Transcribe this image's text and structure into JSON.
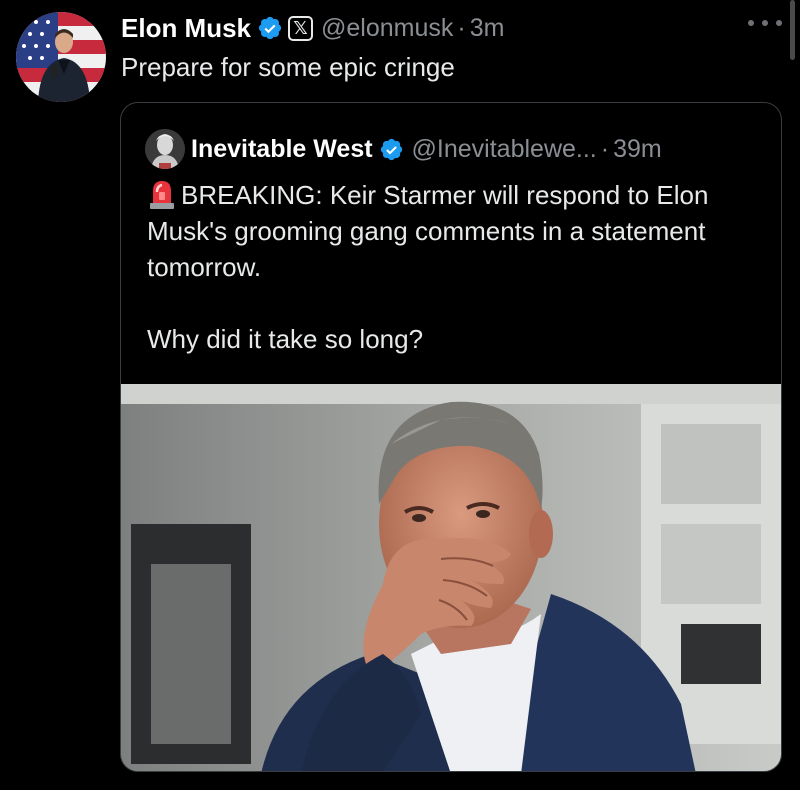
{
  "tweet": {
    "author_name": "Elon Musk",
    "handle": "@elonmusk",
    "separator": "·",
    "time": "3m",
    "text": "Prepare for some epic cringe",
    "verified_icon": "verified-badge-icon",
    "affiliation_icon": "x-logo-icon",
    "affiliation_label": "𝕏",
    "more_icon": "more-options-icon"
  },
  "quoted_tweet": {
    "author_name": "Inevitable West",
    "handle": "@Inevitablewe...",
    "separator": "·",
    "time": "39m",
    "emoji_icon": "rotating-siren-icon",
    "text_lines": [
      "BREAKING: Keir Starmer will respond to Elon Musk's grooming gang comments in a statement tomorrow.",
      "Why did it take so long?"
    ],
    "media_description_icon": "photo"
  },
  "colors": {
    "background": "#000000",
    "text": "#e7e9ea",
    "secondary_text": "#8b8f94",
    "verified_blue": "#1d9bf0",
    "border": "#3a3d41"
  }
}
